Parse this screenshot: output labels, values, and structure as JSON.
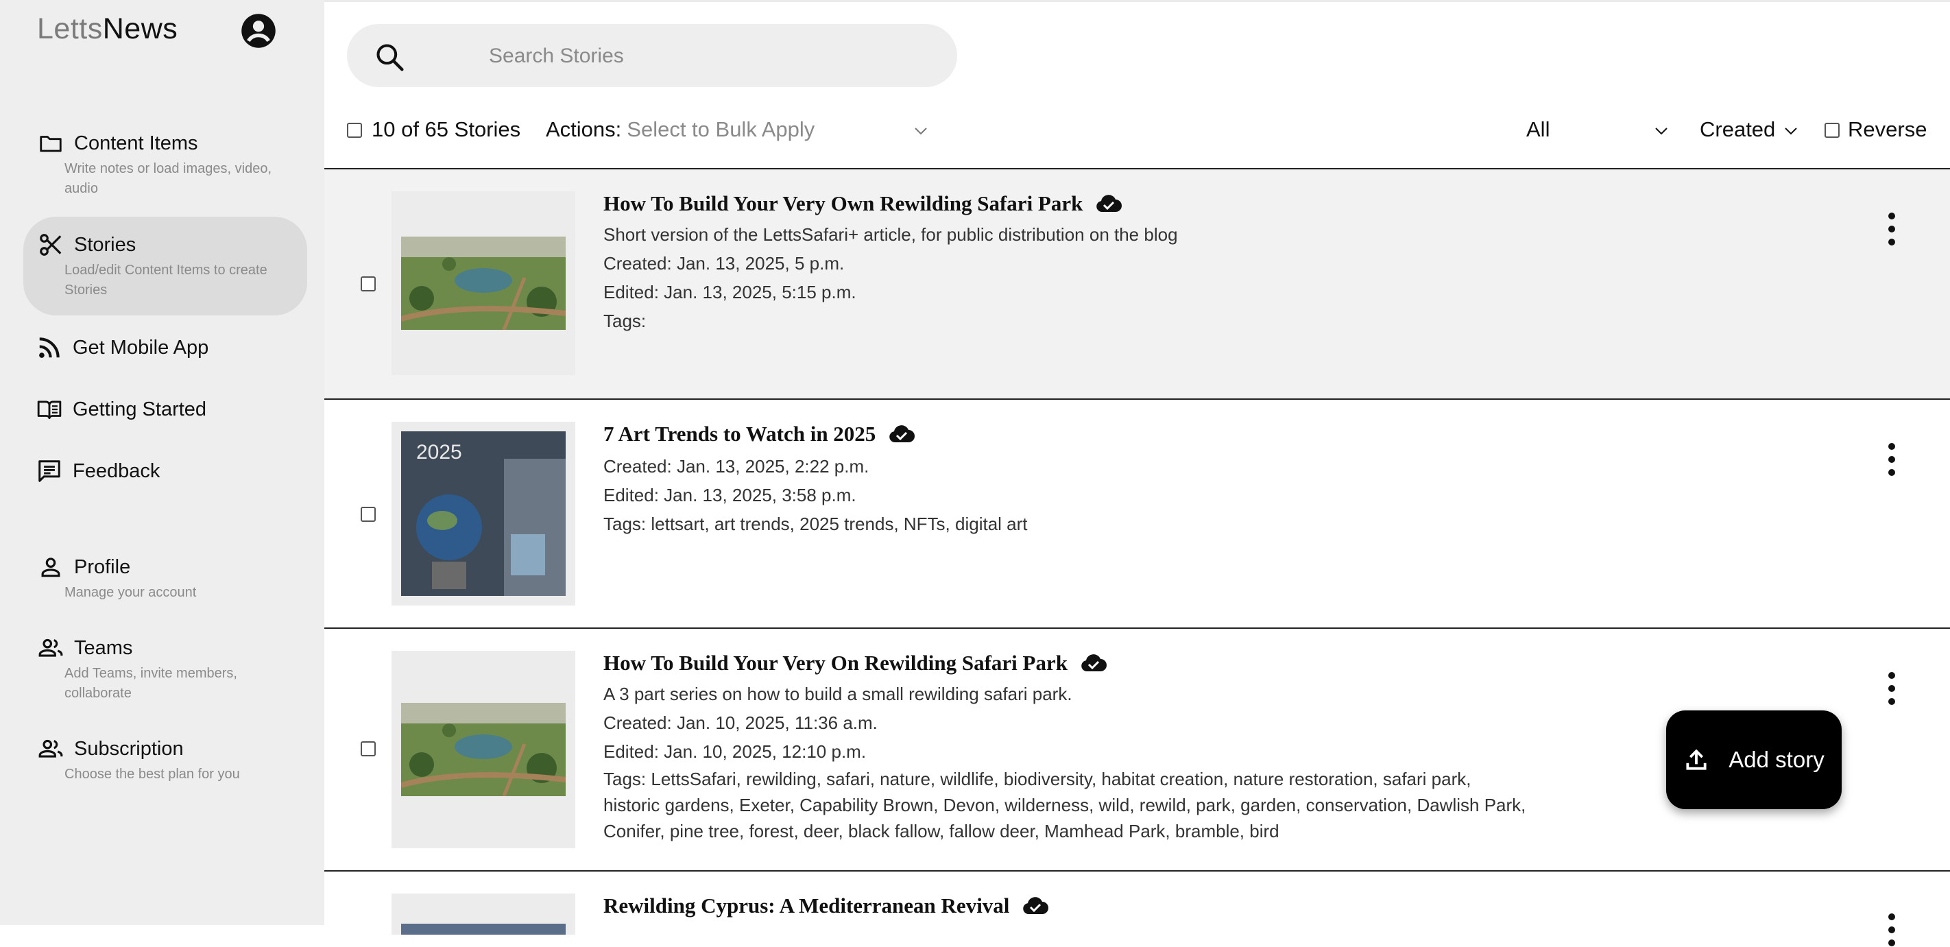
{
  "app": {
    "logo_part1": "Letts",
    "logo_part2": "News"
  },
  "sidebar": {
    "items": [
      {
        "label": "Content Items",
        "desc": "Write notes or load images, video, audio",
        "icon": "folder-icon"
      },
      {
        "label": "Stories",
        "desc": "Load/edit Content Items to create Stories",
        "icon": "scissors-icon",
        "active": true
      },
      {
        "label": "Get Mobile App",
        "icon": "rss-icon"
      },
      {
        "label": "Getting Started",
        "icon": "book-icon"
      },
      {
        "label": "Feedback",
        "icon": "feedback-icon"
      },
      {
        "label": "Profile",
        "desc": "Manage your account",
        "icon": "person-icon"
      },
      {
        "label": "Teams",
        "desc": "Add Teams, invite members, collaborate",
        "icon": "group-icon"
      },
      {
        "label": "Subscription",
        "desc": "Choose the best plan for you",
        "icon": "group-icon"
      }
    ]
  },
  "search": {
    "placeholder": "Search Stories"
  },
  "toolbar": {
    "count": "10 of 65 Stories",
    "actions_label": "Actions:",
    "actions_placeholder": "Select to Bulk Apply",
    "filter": "All",
    "sort": "Created",
    "reverse": "Reverse"
  },
  "stories": [
    {
      "title": "How To Build Your Very Own Rewilding Safari Park",
      "summary": "Short version of the LettsSafari+ article, for public distribution on the blog",
      "created": "Created: Jan. 13, 2025, 5 p.m.",
      "edited": "Edited: Jan. 13, 2025, 5:15 p.m.",
      "tags": "Tags:"
    },
    {
      "title": "7 Art Trends to Watch in 2025",
      "created": "Created: Jan. 13, 2025, 2:22 p.m.",
      "edited": "Edited: Jan. 13, 2025, 3:58 p.m.",
      "tags": "Tags: lettsart, art trends, 2025 trends, NFTs, digital art",
      "thumb_text": "2025"
    },
    {
      "title": "How To Build Your Very On Rewilding Safari Park",
      "summary": "A 3 part series on how to build a small rewilding safari park.",
      "created": "Created: Jan. 10, 2025, 11:36 a.m.",
      "edited": "Edited: Jan. 10, 2025, 12:10 p.m.",
      "tags": "Tags: LettsSafari, rewilding, safari, nature, wildlife, biodiversity, habitat creation, nature restoration, safari park, historic gardens, Exeter, Capability Brown, Devon, wilderness, wild, rewild, park, garden, conservation, Dawlish Park, Conifer, pine tree, forest, deer, black fallow, fallow deer, Mamhead Park, bramble, bird"
    },
    {
      "title": "Rewilding Cyprus: A Mediterranean Revival"
    }
  ],
  "fab": {
    "label": "Add story"
  }
}
